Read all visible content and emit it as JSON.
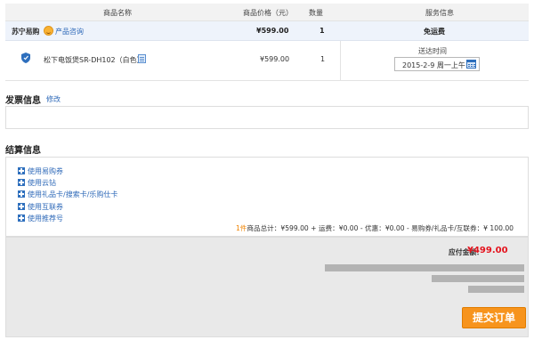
{
  "table_header": {
    "name": "商品名称",
    "price": "商品价格（元）",
    "qty": "数量",
    "service": "服务信息"
  },
  "shop": {
    "logo": "苏宁易购",
    "consult": "产品咨询",
    "price": "¥599.00",
    "qty": "1",
    "shipping": "免运费"
  },
  "item": {
    "name": "松下电饭煲SR-DH102（白色）",
    "price": "¥599.00",
    "qty": "1",
    "delivery_label": "送达时间",
    "delivery_date": "2015-2-9 周一上午"
  },
  "invoice": {
    "title": "发票信息",
    "modify": "修改"
  },
  "settlement": {
    "title": "结算信息",
    "options": [
      "使用易购券",
      "使用云钻",
      "使用礼品卡/搜索卡/乐购仕卡",
      "使用互联券",
      "使用推荐号"
    ],
    "summary_count": "1件",
    "summary_text": "商品总计：¥599.00 + 运费：¥0.00 - 优惠：¥0.00 - 易购券/礼品卡/互联券：¥ 100.00"
  },
  "payment": {
    "label": "应付金额：",
    "amount": "¥499.00",
    "submit": "提交订单"
  },
  "colors": {
    "link": "#2e69b8",
    "price_red": "#e4141e",
    "button_orange": "#f7941d"
  }
}
